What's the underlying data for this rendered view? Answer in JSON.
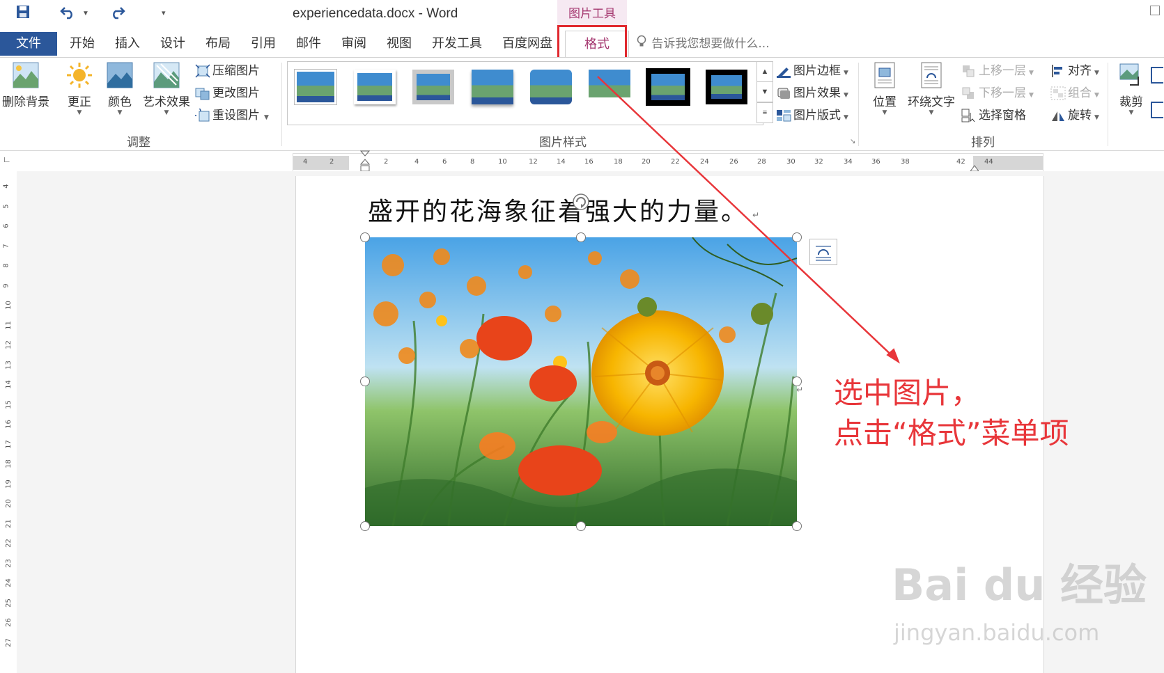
{
  "window": {
    "title": "experiencedata.docx - Word",
    "context_tab_group": "图片工具"
  },
  "tabs": [
    {
      "label": "文件"
    },
    {
      "label": "开始"
    },
    {
      "label": "插入"
    },
    {
      "label": "设计"
    },
    {
      "label": "布局"
    },
    {
      "label": "引用"
    },
    {
      "label": "邮件"
    },
    {
      "label": "审阅"
    },
    {
      "label": "视图"
    },
    {
      "label": "开发工具"
    },
    {
      "label": "百度网盘"
    },
    {
      "label": "格式"
    }
  ],
  "tell_me": "告诉我您想要做什么...",
  "ribbon": {
    "adjust": {
      "remove_background": "删除背景",
      "corrections": "更正",
      "color": "颜色",
      "artistic_effects": "艺术效果",
      "compress": "压缩图片",
      "change_picture": "更改图片",
      "reset_picture": "重设图片",
      "group_label": "调整"
    },
    "picture_styles": {
      "group_label": "图片样式",
      "picture_border": "图片边框",
      "picture_effects": "图片效果",
      "picture_layout": "图片版式"
    },
    "arrange": {
      "position": "位置",
      "wrap_text": "环绕文字",
      "bring_forward": "上移一层",
      "send_backward": "下移一层",
      "selection_pane": "选择窗格",
      "align": "对齐",
      "group": "组合",
      "rotate": "旋转",
      "group_label": "排列"
    },
    "size": {
      "crop": "裁剪"
    }
  },
  "hruler_ticks": [
    "4",
    "2",
    "2",
    "4",
    "6",
    "8",
    "10",
    "12",
    "14",
    "16",
    "18",
    "20",
    "22",
    "24",
    "26",
    "28",
    "30",
    "32",
    "34",
    "36",
    "38",
    "42",
    "44"
  ],
  "vruler_ticks": [
    "4",
    "5",
    "6",
    "7",
    "8",
    "9",
    "10",
    "11",
    "12",
    "13",
    "14",
    "15",
    "16",
    "17",
    "18",
    "19",
    "20",
    "21",
    "22",
    "23",
    "24",
    "25",
    "26",
    "27"
  ],
  "document": {
    "text": "盛开的花海象征着强大的力量。"
  },
  "annotation": {
    "line1": "选中图片，",
    "line2": "点击“格式”菜单项"
  },
  "watermark": {
    "main": "Bai du 经验",
    "sub": "jingyan.baidu.com"
  },
  "colors": {
    "file_tab": "#2b579a",
    "context_accent": "#a4376f",
    "annotation_red": "#e8363a"
  }
}
